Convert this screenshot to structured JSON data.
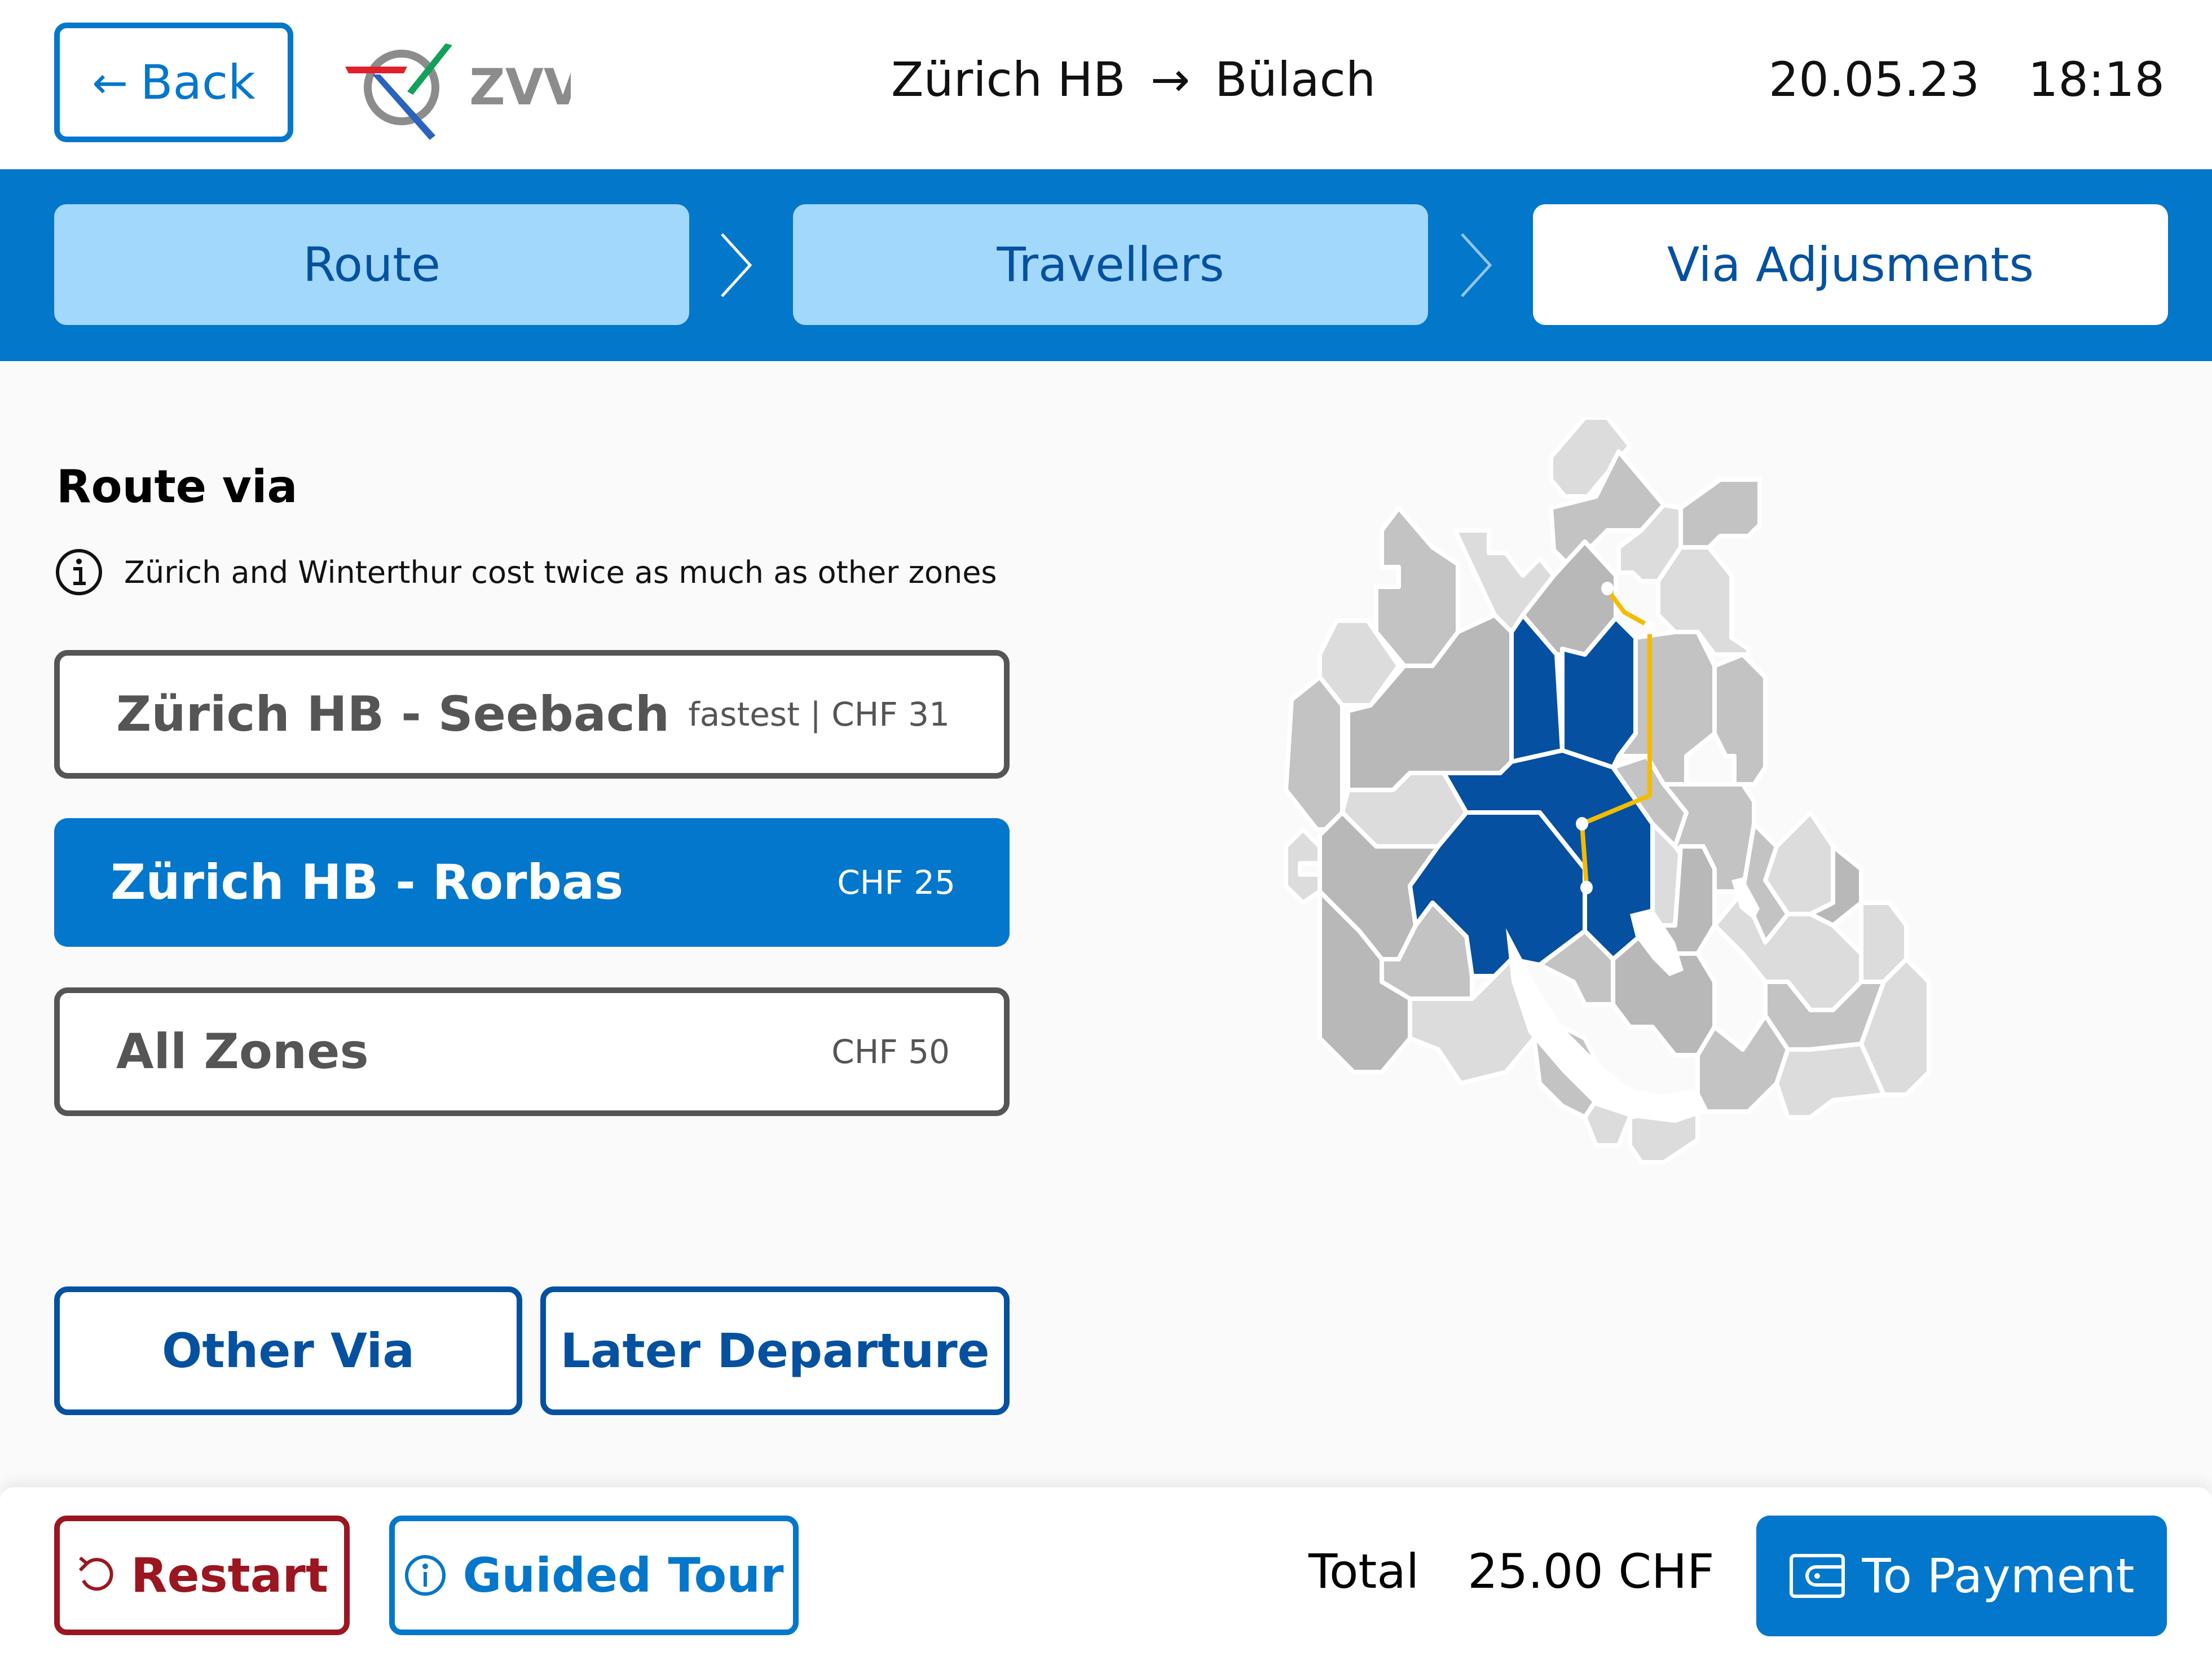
{
  "header": {
    "back_label": "Back",
    "logo_text": "ZVV",
    "route": {
      "from": "Zürich HB",
      "arrow": "→",
      "to": "Bülach"
    },
    "date": "20.05.23",
    "time": "18:18"
  },
  "steps": [
    {
      "label": "Route",
      "state": "done"
    },
    {
      "label": "Travellers",
      "state": "done"
    },
    {
      "label": "Via Adjusments",
      "state": "active"
    }
  ],
  "main": {
    "title": "Route via",
    "info_text": "Zürich and Winterthur cost twice as much as other zones",
    "options": [
      {
        "name": "Zürich HB - Seebach",
        "price": "fastest | CHF 31",
        "selected": false
      },
      {
        "name": "Zürich HB - Rorbas",
        "price": "CHF 25",
        "selected": true
      },
      {
        "name": "All Zones",
        "price": "CHF 50",
        "selected": false
      }
    ],
    "other_via_label": "Other Via",
    "later_departure_label": "Later Departure"
  },
  "map": {
    "highlight_color": "#0550a0",
    "route_color": "#f5bb00",
    "zone_colors": [
      "#b8b8b8",
      "#c3c3c3",
      "#dcdcdc"
    ],
    "stops": 4
  },
  "footer": {
    "restart_label": "Restart",
    "tour_label": "Guided Tour",
    "total_label": "Total",
    "total_value": "25.00 CHF",
    "pay_label": "To Payment"
  },
  "colors": {
    "primary": "#0377cc",
    "dark_blue": "#0551a0",
    "light_blue": "#a3d8fd",
    "danger": "#9b1620"
  }
}
